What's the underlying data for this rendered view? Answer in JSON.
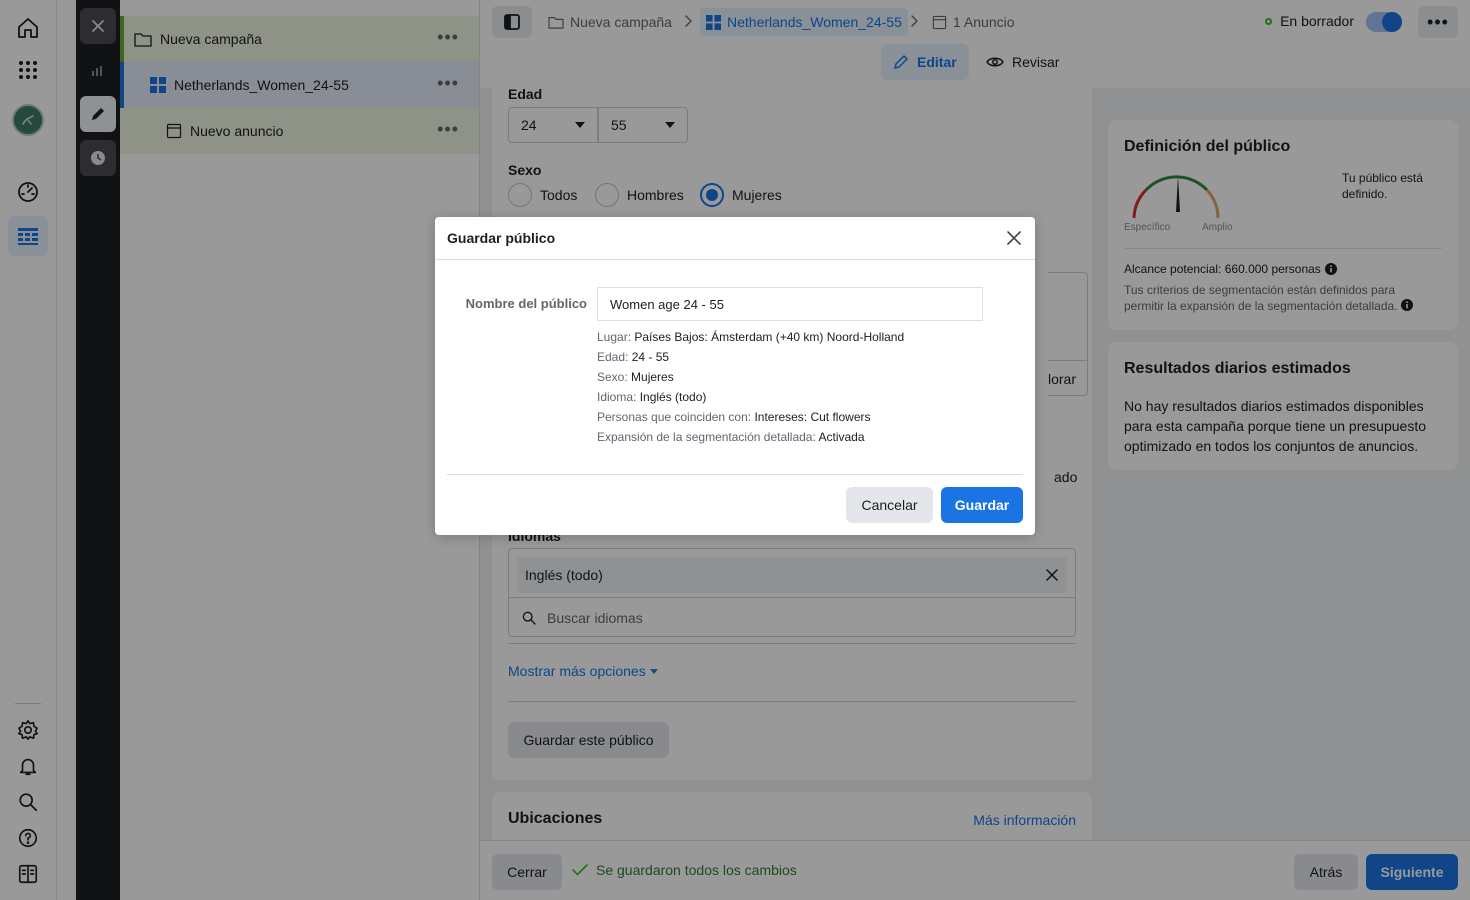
{
  "tree": {
    "campaign": "Nueva campaña",
    "adset": "Netherlands_Women_24-55",
    "ad": "Nuevo anuncio",
    "more": "•••"
  },
  "header": {
    "crumb_campaign": "Nueva campaña",
    "crumb_adset": "Netherlands_Women_24-55",
    "crumb_ad": "1 Anuncio",
    "status": "En borrador",
    "more": "•••",
    "edit_label": "Editar",
    "review_label": "Revisar"
  },
  "form": {
    "age_label": "Edad",
    "age_min": "24",
    "age_max": "55",
    "sex_label": "Sexo",
    "sex_options": [
      "Todos",
      "Hombres",
      "Mujeres"
    ],
    "sex_selected": "Mujeres",
    "partial_explore": "lorar",
    "partial_ado": "ado",
    "languages_label": "Idiomas",
    "language_chip": "Inglés (todo)",
    "language_search_placeholder": "Buscar idiomas",
    "more_options": "Mostrar más opciones",
    "save_audience": "Guardar este público",
    "placements_title": "Ubicaciones",
    "more_info": "Más información"
  },
  "right": {
    "audience_title": "Definición del público",
    "gauge_specific": "Específico",
    "gauge_broad": "Amplio",
    "defined_text": "Tu público está definido.",
    "reach": "Alcance potencial: 660.000 personas",
    "criteria_note": "Tus criterios de segmentación están definidos para permitir la expansión de la segmentación detallada.",
    "daily_title": "Resultados diarios estimados",
    "daily_text": "No hay resultados diarios estimados disponibles para esta campaña porque tiene un presupuesto optimizado en todos los conjuntos de anuncios."
  },
  "footer": {
    "close": "Cerrar",
    "saved_status": "Se guardaron todos los cambios",
    "back": "Atrás",
    "next": "Siguiente"
  },
  "modal": {
    "title": "Guardar público",
    "name_label": "Nombre del público",
    "name_value": "Women age 24 - 55",
    "summary": [
      {
        "key": "Lugar: ",
        "value": "Países Bajos: Ámsterdam (+40 km) Noord-Holland"
      },
      {
        "key": "Edad: ",
        "value": "24 - 55"
      },
      {
        "key": "Sexo: ",
        "value": "Mujeres"
      },
      {
        "key": "Idioma: ",
        "value": "Inglés (todo)"
      },
      {
        "key": "Personas que coinciden con: ",
        "value": "Intereses: Cut flowers"
      },
      {
        "key": "Expansión de la segmentación detallada: ",
        "value": "Activada"
      }
    ],
    "cancel": "Cancelar",
    "save": "Guardar"
  },
  "colors": {
    "accent": "#1b74e4",
    "campaign_bar": "#6ea833",
    "success": "#42b72a"
  }
}
